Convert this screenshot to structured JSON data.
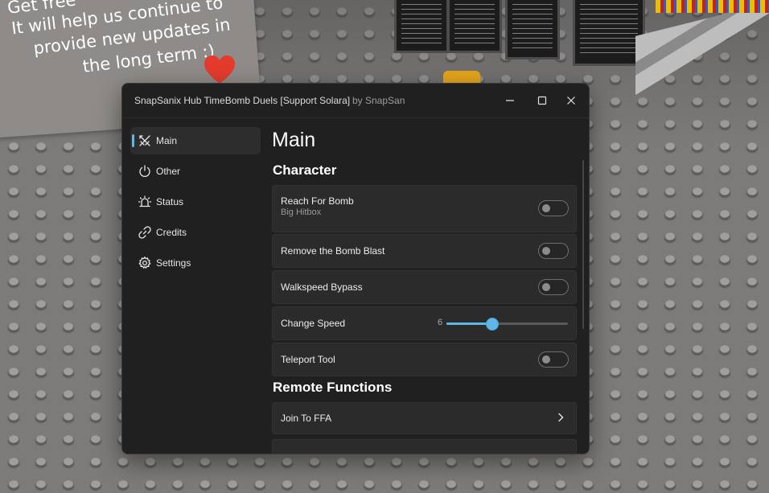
{
  "background": {
    "sign_lines": [
      "Get free",
      "It will help us continue to",
      "provide new updates in",
      "the long term :)"
    ]
  },
  "window": {
    "title": "SnapSanix Hub TimeBomb Duels [Support Solara]",
    "subtitle": "by SnapSan",
    "controls": {
      "minimize_icon": "minimize-icon",
      "maximize_icon": "maximize-icon",
      "close_icon": "close-icon"
    }
  },
  "sidebar": {
    "items": [
      {
        "label": "Main",
        "icon": "crossed-swords-icon",
        "active": true
      },
      {
        "label": "Other",
        "icon": "power-icon",
        "active": false
      },
      {
        "label": "Status",
        "icon": "siren-icon",
        "active": false
      },
      {
        "label": "Credits",
        "icon": "link-icon",
        "active": false
      },
      {
        "label": "Settings",
        "icon": "gear-icon",
        "active": false
      }
    ]
  },
  "main": {
    "title": "Main",
    "sections": {
      "character": "Character",
      "remote": "Remote Functions"
    },
    "rows": {
      "reach": {
        "title": "Reach For Bomb",
        "desc": "Big Hitbox",
        "enabled": false
      },
      "blast": {
        "title": "Remove the Bomb Blast",
        "enabled": false
      },
      "walkspeed": {
        "title": "Walkspeed Bypass",
        "enabled": false
      },
      "speed": {
        "title": "Change Speed",
        "value": "6",
        "fraction": 0.37
      },
      "teleport": {
        "title": "Teleport Tool",
        "enabled": false
      },
      "ffa": {
        "title": "Join To FFA",
        "icon": "chevron-right-icon"
      }
    }
  },
  "colors": {
    "accent": "#5fb7e8",
    "window_bg": "#202020",
    "row_bg": "#2b2b2b"
  }
}
